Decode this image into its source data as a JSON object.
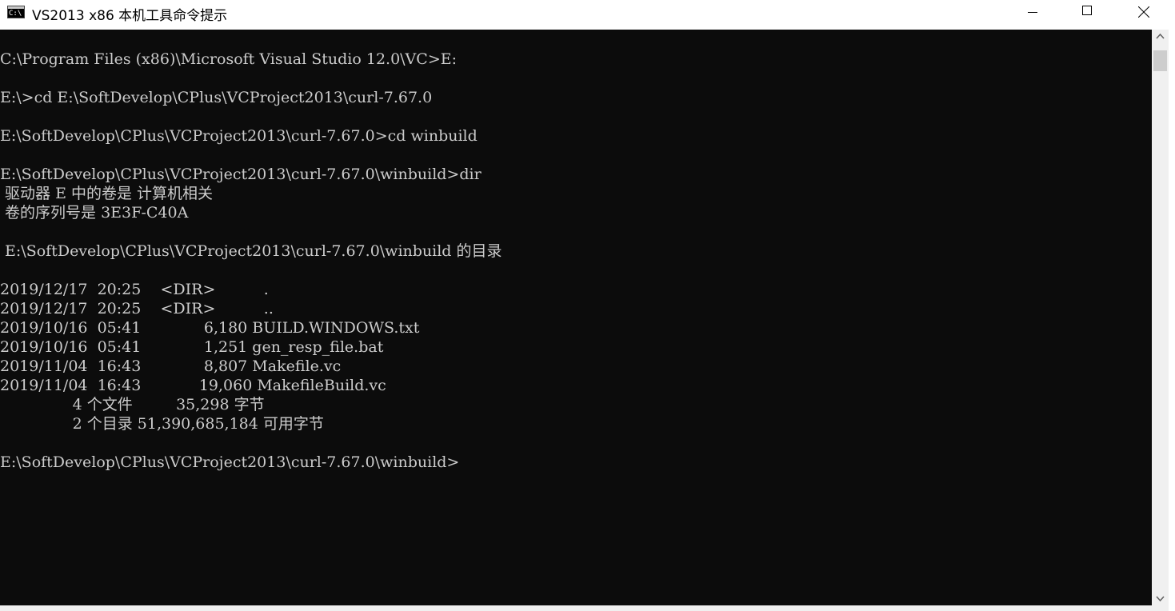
{
  "window": {
    "title": "VS2013 x86 本机工具命令提示",
    "icon_label": "C:\\",
    "icon": "console-icon"
  },
  "controls": {
    "minimize_icon": "minimize-icon",
    "maximize_icon": "maximize-icon",
    "close_icon": "close-icon"
  },
  "console": {
    "text": "C:\\Program Files (x86)\\Microsoft Visual Studio 12.0\\VC>E:\n\nE:\\>cd E:\\SoftDevelop\\CPlus\\VCProject2013\\curl-7.67.0\n\nE:\\SoftDevelop\\CPlus\\VCProject2013\\curl-7.67.0>cd winbuild\n\nE:\\SoftDevelop\\CPlus\\VCProject2013\\curl-7.67.0\\winbuild>dir\n 驱动器 E 中的卷是 计算机相关\n 卷的序列号是 3E3F-C40A\n\n E:\\SoftDevelop\\CPlus\\VCProject2013\\curl-7.67.0\\winbuild 的目录\n\n2019/12/17  20:25    <DIR>          .\n2019/12/17  20:25    <DIR>          ..\n2019/10/16  05:41             6,180 BUILD.WINDOWS.txt\n2019/10/16  05:41             1,251 gen_resp_file.bat\n2019/11/04  16:43             8,807 Makefile.vc\n2019/11/04  16:43            19,060 MakefileBuild.vc\n               4 个文件         35,298 字节\n               2 个目录 51,390,685,184 可用字节\n\nE:\\SoftDevelop\\CPlus\\VCProject2013\\curl-7.67.0\\winbuild>",
    "background_color": "#0c0c0c",
    "text_color": "#cccccc"
  }
}
